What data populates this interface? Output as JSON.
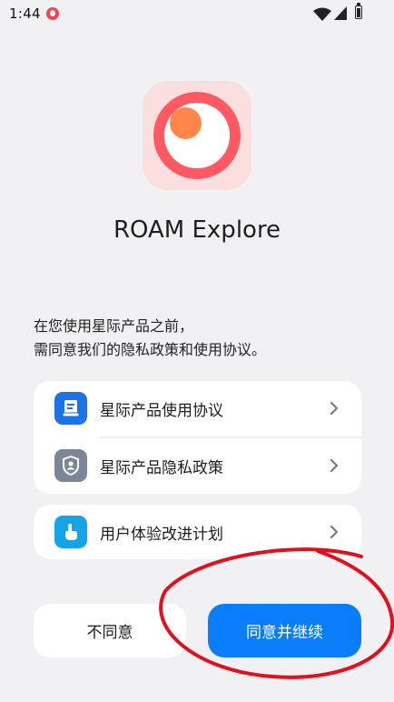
{
  "status_bar": {
    "time": "1:44",
    "icons": [
      "notification-icon",
      "wifi-icon",
      "signal-icon",
      "battery-icon"
    ]
  },
  "app": {
    "name": "ROAM Explore",
    "logo_colors": {
      "background": "#fbdede",
      "ring": "#ff5a63",
      "accent": "#ff8648"
    }
  },
  "intro": {
    "line1": "在您使用星际产品之前，",
    "line2": "需同意我们的隐私政策和使用协议。"
  },
  "agreements": [
    {
      "label": "星际产品使用协议",
      "icon": "document-icon",
      "color": "#1a73e8"
    },
    {
      "label": "星际产品隐私政策",
      "icon": "shield-user-icon",
      "color": "#7b8799"
    }
  ],
  "improvement": {
    "label": "用户体验改进计划",
    "icon": "hand-tap-icon",
    "color": "#16a4e9"
  },
  "buttons": {
    "disagree": "不同意",
    "agree": "同意并继续"
  },
  "colors": {
    "primary": "#0a7dfa",
    "annotation": "#e0101c"
  }
}
